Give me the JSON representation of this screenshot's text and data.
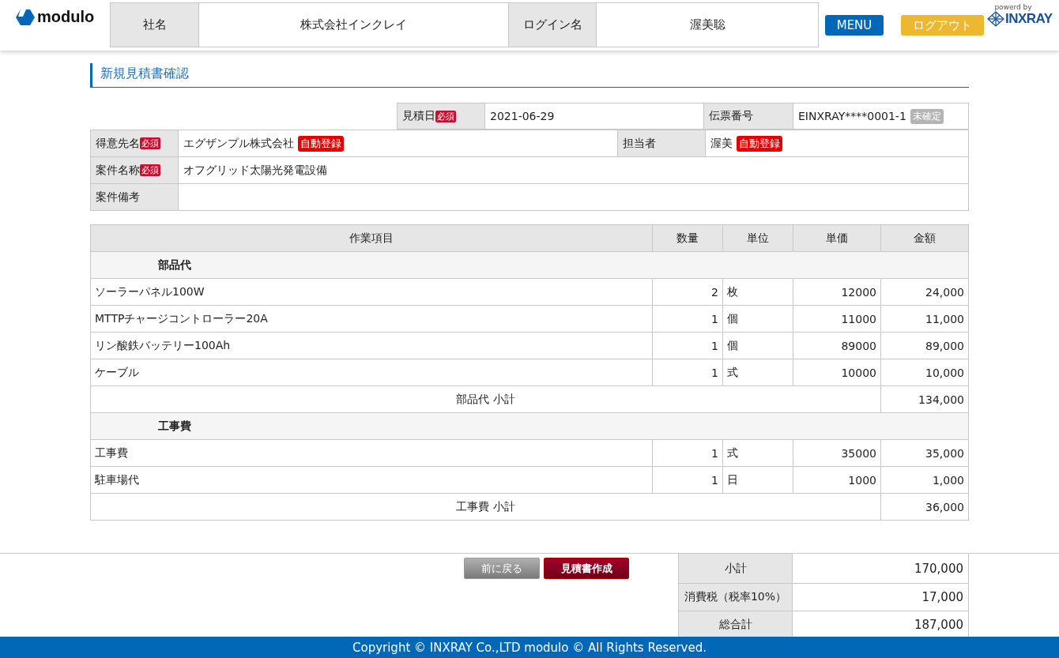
{
  "header": {
    "logo": "modulo",
    "company_label": "社名",
    "company": "株式会社インクレイ",
    "login_label": "ログイン名",
    "login": "渥美聡",
    "menu_button": "MENU",
    "logout_button": "ログアウト",
    "powered_by": "powerd by",
    "brand": "INXRAY"
  },
  "page_title": "新規見積書確認",
  "info": {
    "estimate_date": {
      "label": "見積日",
      "required_badge": "必須",
      "value": "2021-06-29"
    },
    "slip_number": {
      "label": "伝票番号",
      "value": "EINXRAY****0001-1",
      "status": "未確定"
    },
    "customer": {
      "label": "得意先名",
      "required_badge": "必須",
      "value": "エグザンプル株式会社",
      "tag": "自動登録"
    },
    "staff": {
      "label": "担当者",
      "value": "渥美",
      "tag": "自動登録"
    },
    "project_name": {
      "label": "案件名称",
      "required_badge": "必須",
      "value": "オフグリッド太陽光発電設備"
    },
    "project_note": {
      "label": "案件備考"
    }
  },
  "items": {
    "columns": [
      "作業項目",
      "数量",
      "単位",
      "単価",
      "金額"
    ],
    "rows": [
      {
        "kind": "group",
        "label": "部品代"
      },
      {
        "kind": "item",
        "name": "ソーラーパネル100W",
        "qty": "2",
        "unit": "枚",
        "price": "12000",
        "amount": "24,000"
      },
      {
        "kind": "item",
        "name": "MTTPチャージコントローラー20A",
        "qty": "1",
        "unit": "個",
        "price": "11000",
        "amount": "11,000"
      },
      {
        "kind": "item",
        "name": "リン酸鉄バッテリー100Ah",
        "qty": "1",
        "unit": "個",
        "price": "89000",
        "amount": "89,000"
      },
      {
        "kind": "item",
        "name": "ケーブル",
        "qty": "1",
        "unit": "式",
        "price": "10000",
        "amount": "10,000"
      },
      {
        "kind": "subtotal",
        "label": "部品代 小計",
        "amount": "134,000"
      },
      {
        "kind": "group",
        "label": "工事費"
      },
      {
        "kind": "item",
        "name": "工事費",
        "qty": "1",
        "unit": "式",
        "price": "35000",
        "amount": "35,000"
      },
      {
        "kind": "item",
        "name": "駐車場代",
        "qty": "1",
        "unit": "日",
        "price": "1000",
        "amount": "1,000"
      },
      {
        "kind": "subtotal",
        "label": "工事費 小計",
        "amount": "36,000"
      }
    ]
  },
  "buttons": {
    "back": "前に戻る",
    "create": "見積書作成"
  },
  "totals": [
    {
      "label": "小計",
      "value": "170,000"
    },
    {
      "label": "消費税（税率10%）",
      "value": "17,000"
    },
    {
      "label": "総合計",
      "value": "187,000"
    }
  ],
  "footer": "Copyright © INXRAY Co.,LTD modulo © All Rights Reserved."
}
